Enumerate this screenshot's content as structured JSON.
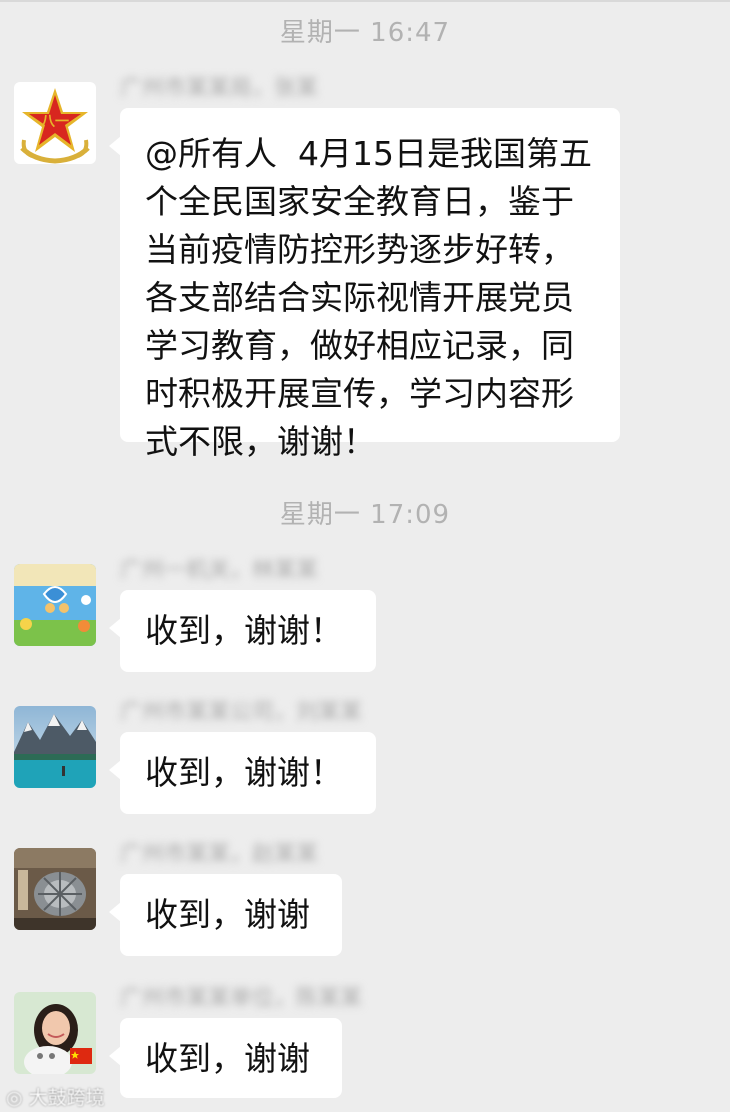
{
  "timestamps": [
    "星期一 16:47",
    "星期一 17:09"
  ],
  "messages": [
    {
      "sender": "广州市某某局，张某",
      "avatar": "army-emblem-icon",
      "text": "@所有人  4月15日是我国第五\n个全民国家安全教育日，鉴于\n当前疫情防控形势逐步好转，\n各支部结合实际视情开展党员\n学习教育，做好相应记录，同\n时积极开展宣传，学习内容形\n式不限，谢谢！"
    },
    {
      "sender": "广州一机关，林某某",
      "avatar": "cartoon-wall-avatar",
      "text": "收到，谢谢！"
    },
    {
      "sender": "广州市某某公司，刘某某",
      "avatar": "mountain-lake-avatar",
      "text": "收到，谢谢！"
    },
    {
      "sender": "广州市某某，赵某某",
      "avatar": "machinery-avatar",
      "text": "收到，谢谢"
    },
    {
      "sender": "广州市某某单位，陈某某",
      "avatar": "woman-with-cat-avatar",
      "text": "收到，谢谢"
    }
  ],
  "watermark": "大鼓跨境"
}
